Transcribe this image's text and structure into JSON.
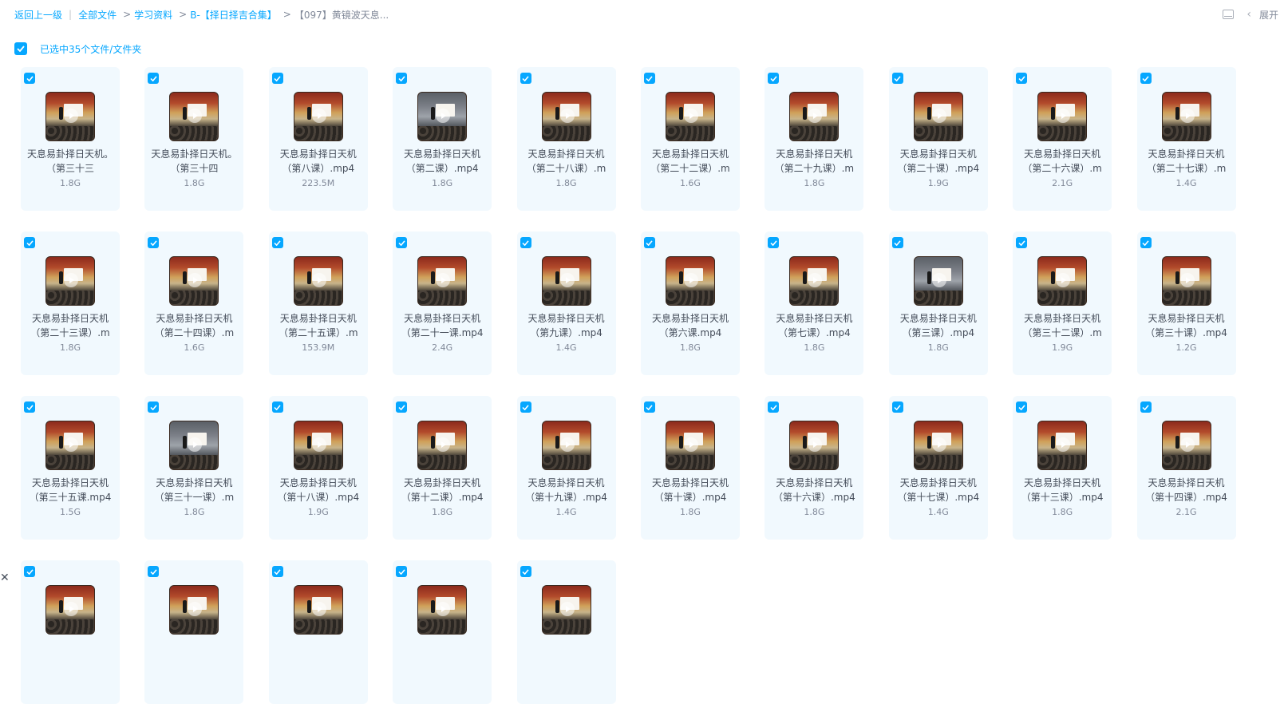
{
  "breadcrumb": {
    "back": "返回上一级",
    "items": [
      "全部文件",
      "学习资料",
      "B-【择日择吉合集】"
    ],
    "current": "【097】黄镜波天息..."
  },
  "top_right": {
    "expand_label": "展开",
    "layout_icon": "layout-icon",
    "chevron": "‹"
  },
  "selection": {
    "label": "已选中35个文件/文件夹"
  },
  "colors": {
    "accent": "#06a7ff",
    "card_bg": "#f1f9fe",
    "text": "#454d5a",
    "muted": "#818999"
  },
  "files": [
    {
      "name": "天息易卦择日天机。（第三十三",
      "size": "1.8G"
    },
    {
      "name": "天息易卦择日天机。（第三十四",
      "size": "1.8G"
    },
    {
      "name": "天息易卦择日天机（第八课）.mp4",
      "size": "223.5M"
    },
    {
      "name": "天息易卦择日天机（第二课）.mp4",
      "size": "1.8G"
    },
    {
      "name": "天息易卦择日天机（第二十八课）.m",
      "size": "1.8G"
    },
    {
      "name": "天息易卦择日天机（第二十二课）.m",
      "size": "1.6G"
    },
    {
      "name": "天息易卦择日天机（第二十九课）.m",
      "size": "1.8G"
    },
    {
      "name": "天息易卦择日天机（第二十课）.mp4",
      "size": "1.9G"
    },
    {
      "name": "天息易卦择日天机（第二十六课）.m",
      "size": "2.1G"
    },
    {
      "name": "天息易卦择日天机（第二十七课）.m",
      "size": "1.4G"
    },
    {
      "name": "天息易卦择日天机（第二十三课）.m",
      "size": "1.8G"
    },
    {
      "name": "天息易卦择日天机（第二十四课）.m",
      "size": "1.6G"
    },
    {
      "name": "天息易卦择日天机（第二十五课）.m",
      "size": "153.9M"
    },
    {
      "name": "天息易卦择日天机（第二十一课.mp4",
      "size": "2.4G"
    },
    {
      "name": "天息易卦择日天机（第九课）.mp4",
      "size": "1.4G"
    },
    {
      "name": "天息易卦择日天机（第六课.mp4",
      "size": "1.8G"
    },
    {
      "name": "天息易卦择日天机（第七课）.mp4",
      "size": "1.8G"
    },
    {
      "name": "天息易卦择日天机（第三课）.mp4",
      "size": "1.8G"
    },
    {
      "name": "天息易卦择日天机（第三十二课）.m",
      "size": "1.9G"
    },
    {
      "name": "天息易卦择日天机（第三十课）.mp4",
      "size": "1.2G"
    },
    {
      "name": "天息易卦择日天机（第三十五课.mp4",
      "size": "1.5G"
    },
    {
      "name": "天息易卦择日天机（第三十一课）.m",
      "size": "1.8G"
    },
    {
      "name": "天息易卦择日天机（第十八课）.mp4",
      "size": "1.9G"
    },
    {
      "name": "天息易卦择日天机（第十二课）.mp4",
      "size": "1.8G"
    },
    {
      "name": "天息易卦择日天机（第十九课）.mp4",
      "size": "1.4G"
    },
    {
      "name": "天息易卦择日天机（第十课）.mp4",
      "size": "1.8G"
    },
    {
      "name": "天息易卦择日天机（第十六课）.mp4",
      "size": "1.8G"
    },
    {
      "name": "天息易卦择日天机（第十七课）.mp4",
      "size": "1.4G"
    },
    {
      "name": "天息易卦择日天机（第十三课）.mp4",
      "size": "1.8G"
    },
    {
      "name": "天息易卦择日天机（第十四课）.mp4",
      "size": "2.1G"
    },
    {
      "name": "",
      "size": ""
    },
    {
      "name": "",
      "size": ""
    },
    {
      "name": "",
      "size": ""
    },
    {
      "name": "",
      "size": ""
    },
    {
      "name": "",
      "size": ""
    }
  ],
  "misc": {
    "close_glyph": "✕"
  }
}
